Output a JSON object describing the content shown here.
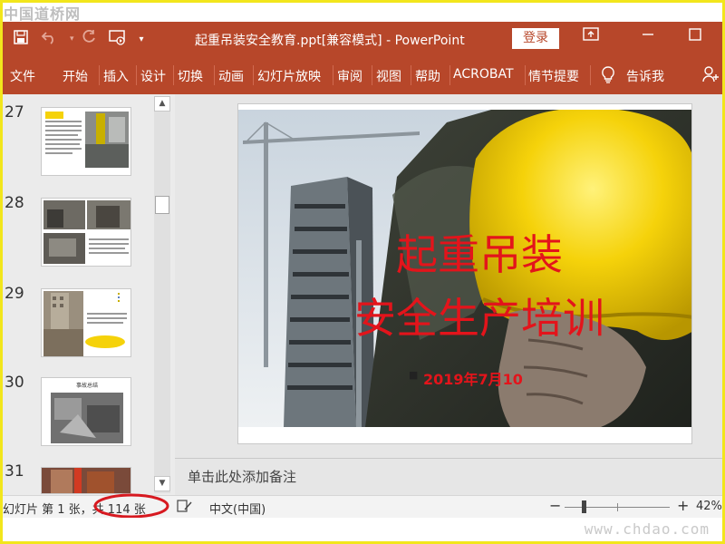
{
  "watermark": {
    "top": "中国道桥网",
    "bottom": "www.chdao.com"
  },
  "titlebar": {
    "document_title": "起重吊装安全教育.ppt[兼容模式] - PowerPoint",
    "login_label": "登录",
    "save_icon": "save-icon",
    "undo_icon": "undo-icon",
    "redo_icon": "redo-icon",
    "present_icon": "present-from-start-icon",
    "customize_icon": "customize-qat-icon"
  },
  "ribbon": {
    "tabs": [
      "文件",
      "开始",
      "插入",
      "设计",
      "切换",
      "动画",
      "幻灯片放映",
      "审阅",
      "视图",
      "帮助",
      "ACROBAT",
      "情节提要"
    ],
    "tell_me": "告诉我"
  },
  "thumbnails": [
    {
      "number": "27"
    },
    {
      "number": "28"
    },
    {
      "number": "29"
    },
    {
      "number": "30",
      "caption": "事故总结"
    },
    {
      "number": "31"
    }
  ],
  "slide": {
    "title_line1": "起重吊装",
    "title_line2": "安全生产培训",
    "bullet": "2019年7月10"
  },
  "notes_placeholder": "单击此处添加备注",
  "status": {
    "slide_info": "幻灯片 第 1 张，共 114 张",
    "language": "中文(中国)",
    "zoom_minus": "−",
    "zoom_plus": "+",
    "zoom_level": "42%",
    "zoom_fraction": 0.42
  },
  "colors": {
    "accent": "#b7472a",
    "slide_title": "#e3141b",
    "helmet": "#f5d20a",
    "highlight_circle": "#d71920"
  }
}
